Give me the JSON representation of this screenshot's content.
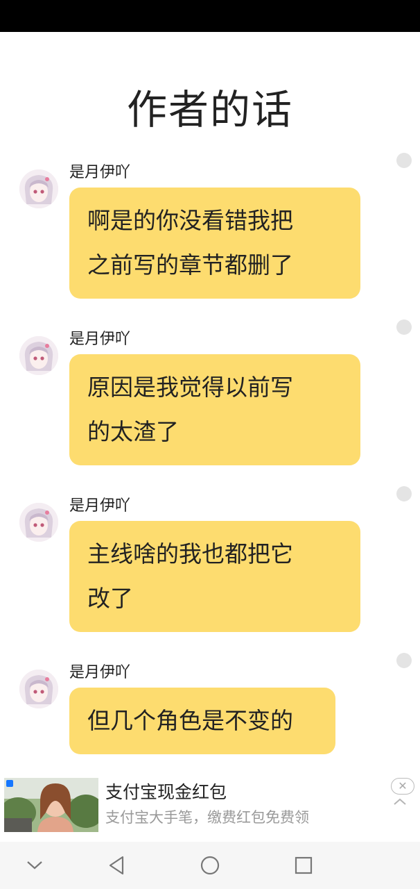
{
  "page": {
    "title": "作者的话"
  },
  "messages": [
    {
      "sender": "是月伊吖",
      "lines": [
        "啊是的你没看错我把",
        "之前写的章节都删了"
      ]
    },
    {
      "sender": "是月伊吖",
      "lines": [
        "原因是我觉得以前写",
        "的太渣了"
      ]
    },
    {
      "sender": "是月伊吖",
      "lines": [
        "主线啥的我也都把它",
        "改了"
      ]
    },
    {
      "sender": "是月伊吖",
      "lines": [
        "但几个角色是不变的"
      ]
    }
  ],
  "ad": {
    "title": "支付宝现金红包",
    "subtitle": "支付宝大手笔，缴费红包免费领",
    "close_icon": "close-icon",
    "expand_icon": "chevron-up-icon"
  },
  "nav": {
    "buttons": [
      "chevron-down-icon",
      "back-triangle-icon",
      "home-circle-icon",
      "recents-square-icon"
    ]
  },
  "colors": {
    "bubble": "#fddc6f",
    "status_dot": "#e4e4e4",
    "status_bar": "#000000",
    "nav_bar": "#f6f6f6"
  }
}
